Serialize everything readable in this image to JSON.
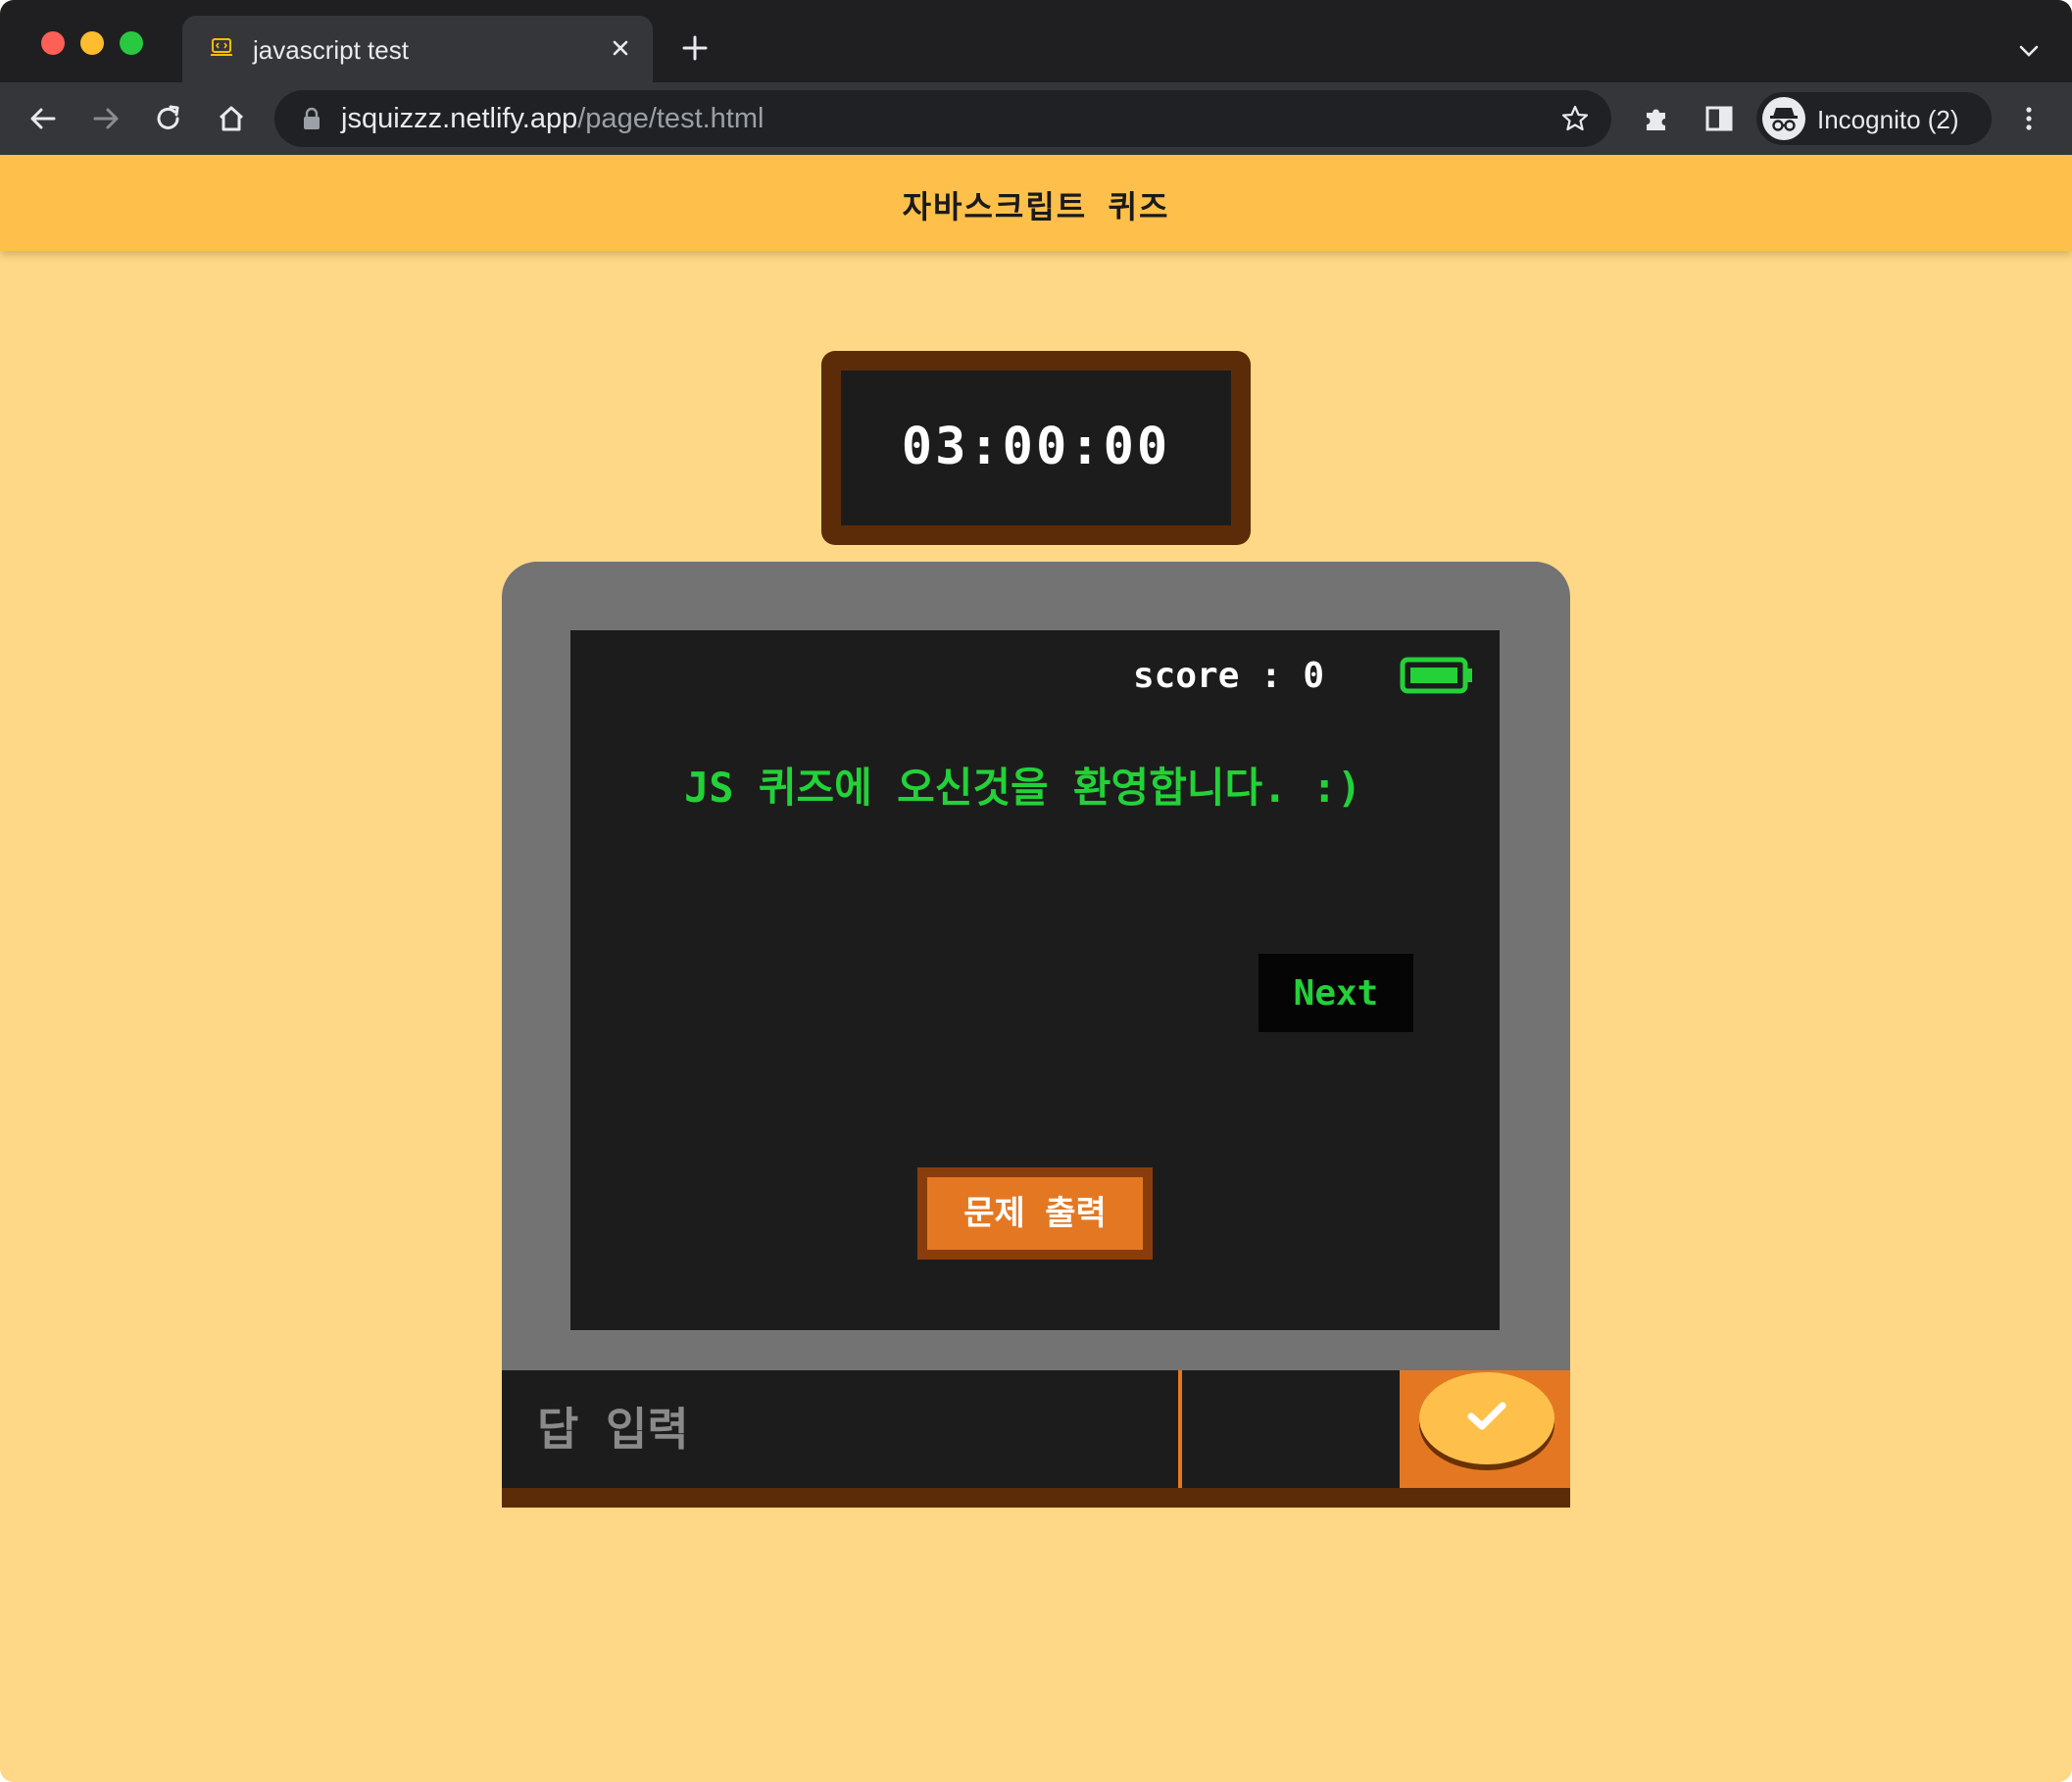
{
  "browser": {
    "tab_title": "javascript test",
    "url_host": "jsquizzz.netlify.app",
    "url_path": "/page/test.html",
    "profile_label": "Incognito (2)"
  },
  "app": {
    "title": "자바스크립트 퀴즈",
    "timer": "03:00:00",
    "score_text": "score : 0",
    "message": "JS 퀴즈에 오신것을 환영합니다. :)",
    "next_label": "Next",
    "print_label": "문제 출력",
    "answer_placeholder": "답 입력"
  },
  "colors": {
    "page_bg": "#ffd887",
    "header_bg": "#ffc04b",
    "accent_orange": "#e47822",
    "brown": "#5c2c08",
    "terminal_green": "#23d138"
  },
  "icons": {
    "battery": "battery-full-icon",
    "submit": "checkmark-icon"
  }
}
